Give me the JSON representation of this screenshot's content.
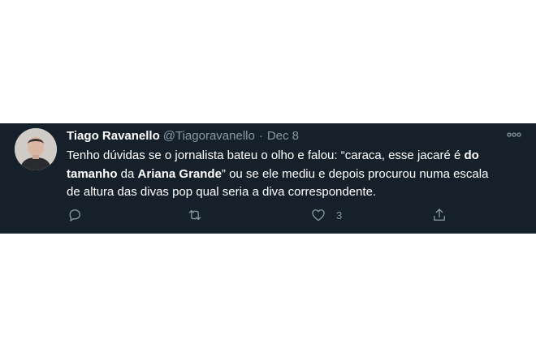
{
  "tweet": {
    "author_name": "Tiago Ravanello",
    "author_handle": "@Tiagoravanello",
    "separator": "·",
    "date": "Dec 8",
    "text_parts": {
      "p1": "Tenho dúvidas se o jornalista bateu o olho e falou: “caraca, esse jacaré é ",
      "b1": "do tamanho",
      "p2": " da ",
      "b2": "Ariana Grande",
      "p3": "” ou se ele mediu e depois procurou numa escala de altura das divas pop qual seria a diva correspondente."
    },
    "like_count": "3"
  },
  "icons": {
    "avatar": "user-photo",
    "more": "more-horizontal-icon",
    "reply": "reply-icon",
    "retweet": "retweet-icon",
    "like": "heart-icon",
    "share": "share-icon"
  },
  "colors": {
    "background": "#15202b",
    "text": "#ffffff",
    "secondary": "#8899a6"
  }
}
